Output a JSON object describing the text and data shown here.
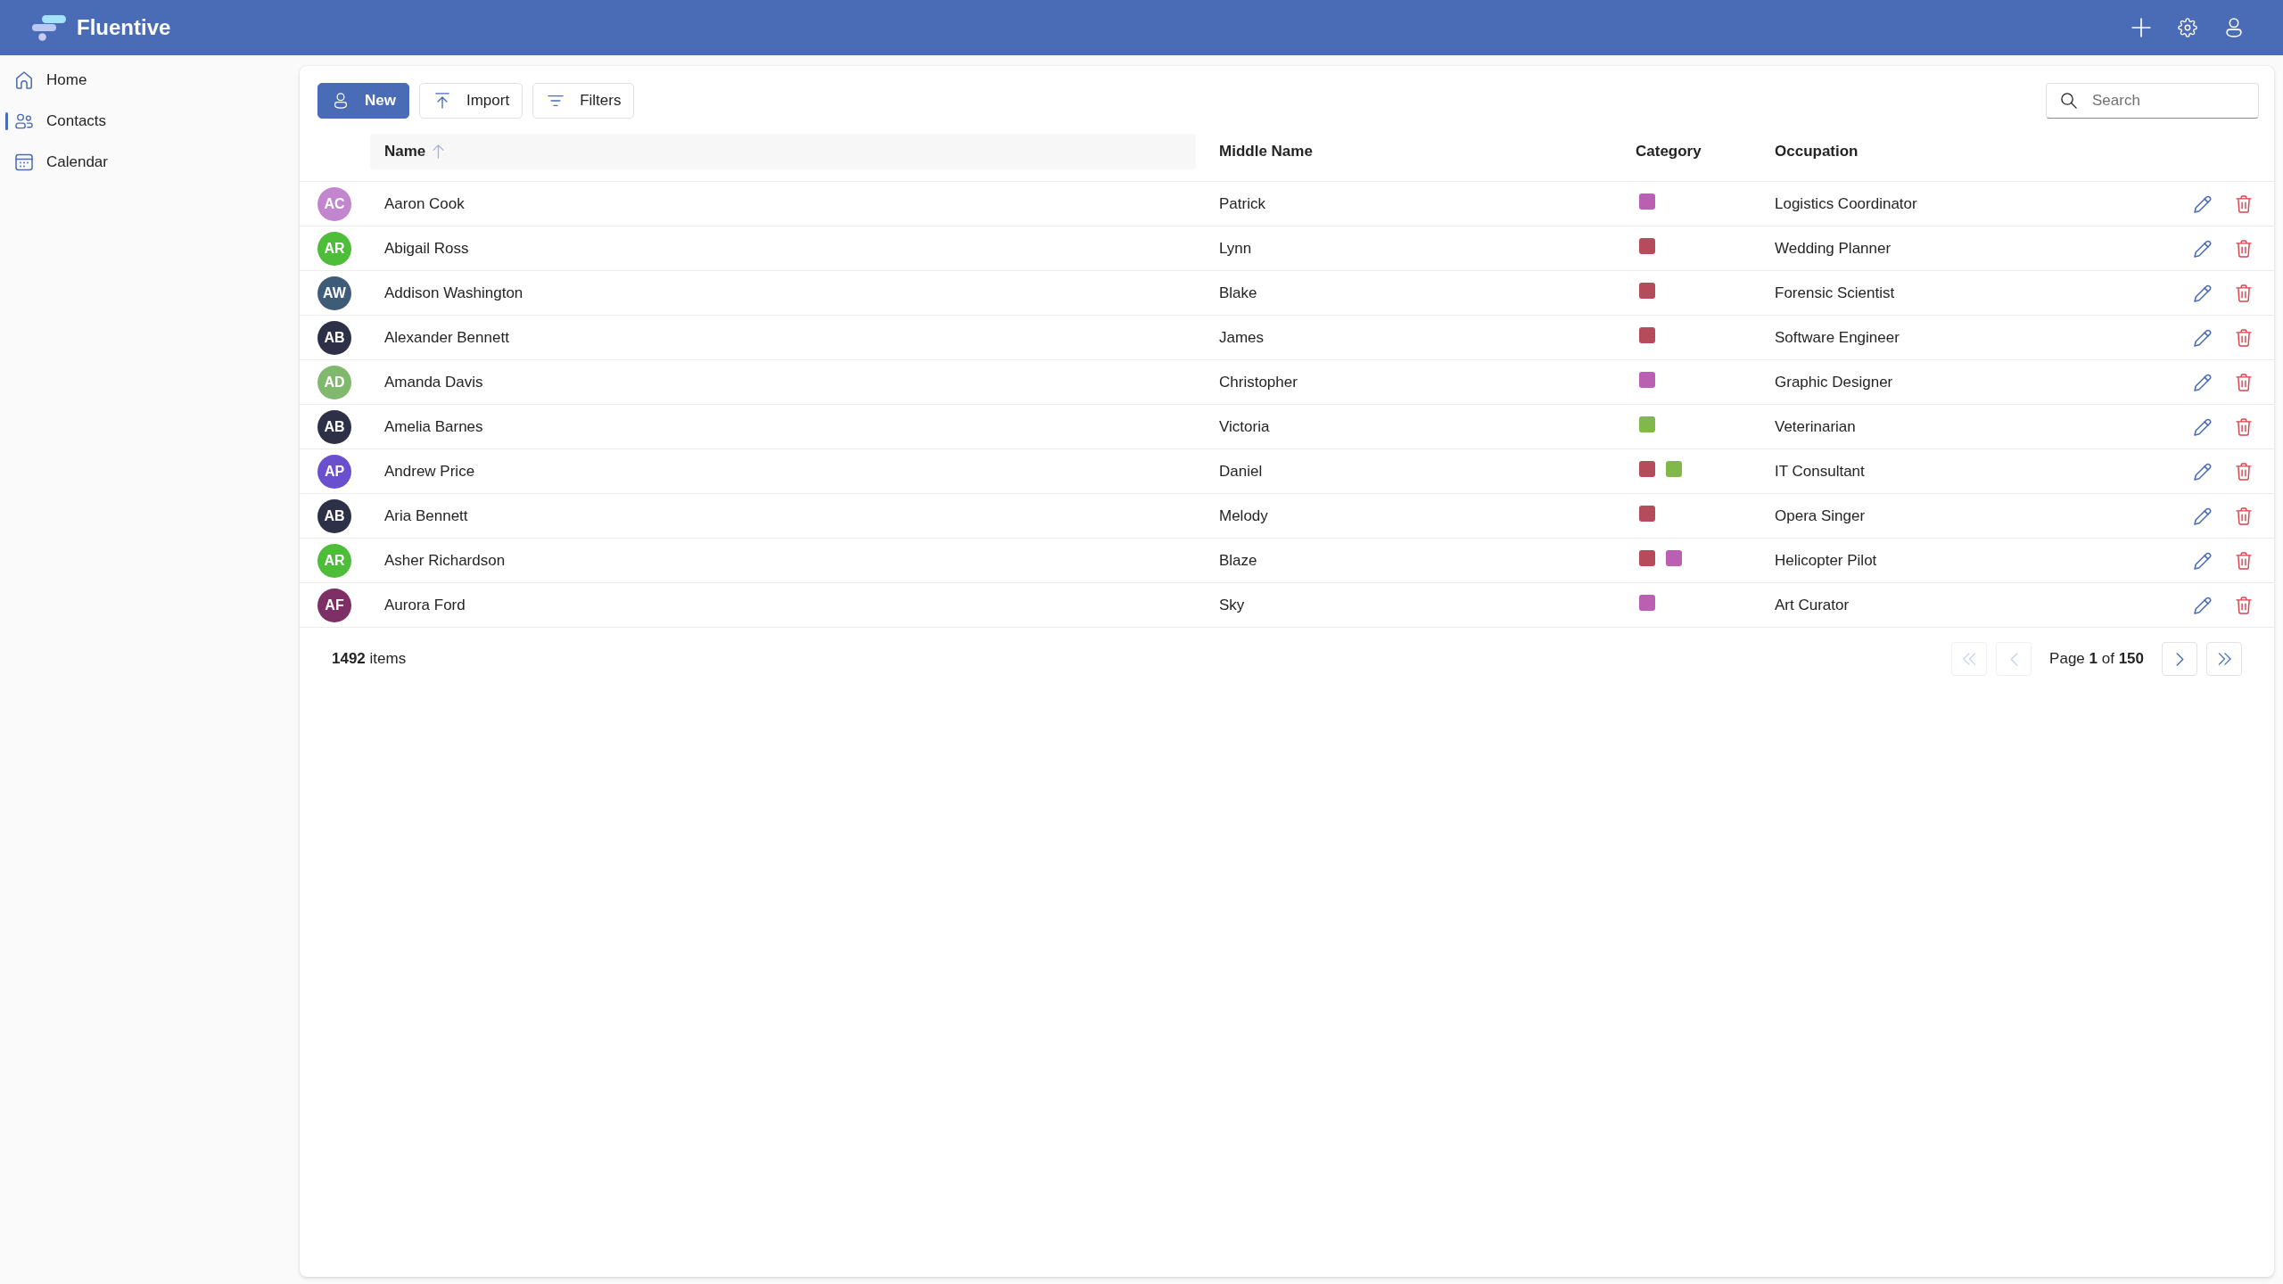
{
  "app": {
    "title": "Fluentive"
  },
  "sidebar": {
    "items": [
      {
        "label": "Home",
        "selected": false
      },
      {
        "label": "Contacts",
        "selected": true
      },
      {
        "label": "Calendar",
        "selected": false
      }
    ]
  },
  "toolbar": {
    "buttons": [
      {
        "label": "New",
        "kind": "primary"
      },
      {
        "label": "Import",
        "kind": "secondary"
      },
      {
        "label": "Filters",
        "kind": "secondary"
      }
    ],
    "search": {
      "placeholder": "Search"
    }
  },
  "table": {
    "columns": [
      {
        "label": "Name",
        "sorted": true
      },
      {
        "label": "Middle Name",
        "sorted": false
      },
      {
        "label": "Category",
        "sorted": false
      },
      {
        "label": "Occupation",
        "sorted": false
      }
    ],
    "rows": [
      {
        "avatar": {
          "initials": "AC",
          "color": "#c286cf"
        },
        "name": "Aaron Cook",
        "middle_name": "Patrick",
        "categories": [
          {
            "color": "#bb5fb3"
          }
        ],
        "occupation": "Logistics Coordinator"
      },
      {
        "avatar": {
          "initials": "AR",
          "color": "#4dbd3a"
        },
        "name": "Abigail Ross",
        "middle_name": "Lynn",
        "categories": [
          {
            "color": "#b54b5b"
          }
        ],
        "occupation": "Wedding Planner"
      },
      {
        "avatar": {
          "initials": "AW",
          "color": "#3e5b78"
        },
        "name": "Addison Washington",
        "middle_name": "Blake",
        "categories": [
          {
            "color": "#b54b5b"
          }
        ],
        "occupation": "Forensic Scientist"
      },
      {
        "avatar": {
          "initials": "AB",
          "color": "#2d3047"
        },
        "name": "Alexander Bennett",
        "middle_name": "James",
        "categories": [
          {
            "color": "#b54b5b"
          }
        ],
        "occupation": "Software Engineer"
      },
      {
        "avatar": {
          "initials": "AD",
          "color": "#80b86e"
        },
        "name": "Amanda Davis",
        "middle_name": "Christopher",
        "categories": [
          {
            "color": "#bb5fb3"
          }
        ],
        "occupation": "Graphic Designer"
      },
      {
        "avatar": {
          "initials": "AB",
          "color": "#2d3047"
        },
        "name": "Amelia Barnes",
        "middle_name": "Victoria",
        "categories": [
          {
            "color": "#80b84a"
          }
        ],
        "occupation": "Veterinarian"
      },
      {
        "avatar": {
          "initials": "AP",
          "color": "#6a4fce"
        },
        "name": "Andrew Price",
        "middle_name": "Daniel",
        "categories": [
          {
            "color": "#b54b5b"
          },
          {
            "color": "#80b84a"
          }
        ],
        "occupation": "IT Consultant"
      },
      {
        "avatar": {
          "initials": "AB",
          "color": "#2d3047"
        },
        "name": "Aria Bennett",
        "middle_name": "Melody",
        "categories": [
          {
            "color": "#b54b5b"
          }
        ],
        "occupation": "Opera Singer"
      },
      {
        "avatar": {
          "initials": "AR",
          "color": "#4dbd3a"
        },
        "name": "Asher Richardson",
        "middle_name": "Blaze",
        "categories": [
          {
            "color": "#b54b5b"
          },
          {
            "color": "#bb5fb3"
          }
        ],
        "occupation": "Helicopter Pilot"
      },
      {
        "avatar": {
          "initials": "AF",
          "color": "#7e2f66"
        },
        "name": "Aurora Ford",
        "middle_name": "Sky",
        "categories": [
          {
            "color": "#bb5fb3"
          }
        ],
        "occupation": "Art Curator"
      }
    ]
  },
  "footer": {
    "count": "**1492** items",
    "pagination": {
      "first": {
        "disabled": true
      },
      "previous": {
        "disabled": true
      },
      "page_label": "Page **1** of **150**",
      "next": {
        "disabled": false
      },
      "last": {
        "disabled": false
      }
    }
  }
}
